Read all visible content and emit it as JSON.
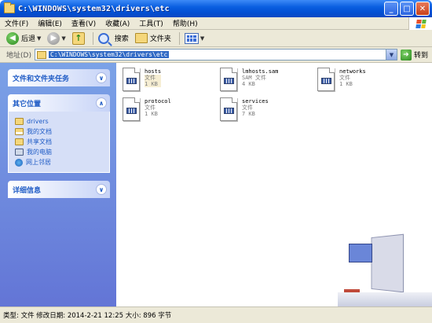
{
  "window": {
    "title": "C:\\WINDOWS\\system32\\drivers\\etc",
    "minimize": "_",
    "maximize": "□",
    "close": "✕"
  },
  "menu": [
    "文件(F)",
    "编辑(E)",
    "查看(V)",
    "收藏(A)",
    "工具(T)",
    "帮助(H)"
  ],
  "toolbar": {
    "back_label": "后退",
    "search_label": "搜索",
    "folders_label": "文件夹"
  },
  "address": {
    "label": "地址(D)",
    "path": "C:\\WINDOWS\\system32\\drivers\\etc",
    "go_label": "转到"
  },
  "sidebar": {
    "tasks_title": "文件和文件夹任务",
    "places_title": "其它位置",
    "places": [
      {
        "label": "drivers",
        "icon": "folder-icon"
      },
      {
        "label": "我的文档",
        "icon": "my-documents-icon"
      },
      {
        "label": "共享文档",
        "icon": "shared-documents-icon"
      },
      {
        "label": "我的电脑",
        "icon": "my-computer-icon"
      },
      {
        "label": "网上邻居",
        "icon": "network-icon"
      }
    ],
    "details_title": "详细信息"
  },
  "files": [
    {
      "name": "hosts",
      "type": "文件",
      "size": "1 KB"
    },
    {
      "name": "lmhosts.sam",
      "type": "SAM 文件",
      "size": "4 KB"
    },
    {
      "name": "networks",
      "type": "文件",
      "size": "1 KB"
    },
    {
      "name": "protocol",
      "type": "文件",
      "size": "1 KB"
    },
    {
      "name": "services",
      "type": "文件",
      "size": "7 KB"
    }
  ],
  "status": {
    "text": "类型: 文件 修改日期: 2014-2-21 12:25 大小: 896 字节"
  }
}
